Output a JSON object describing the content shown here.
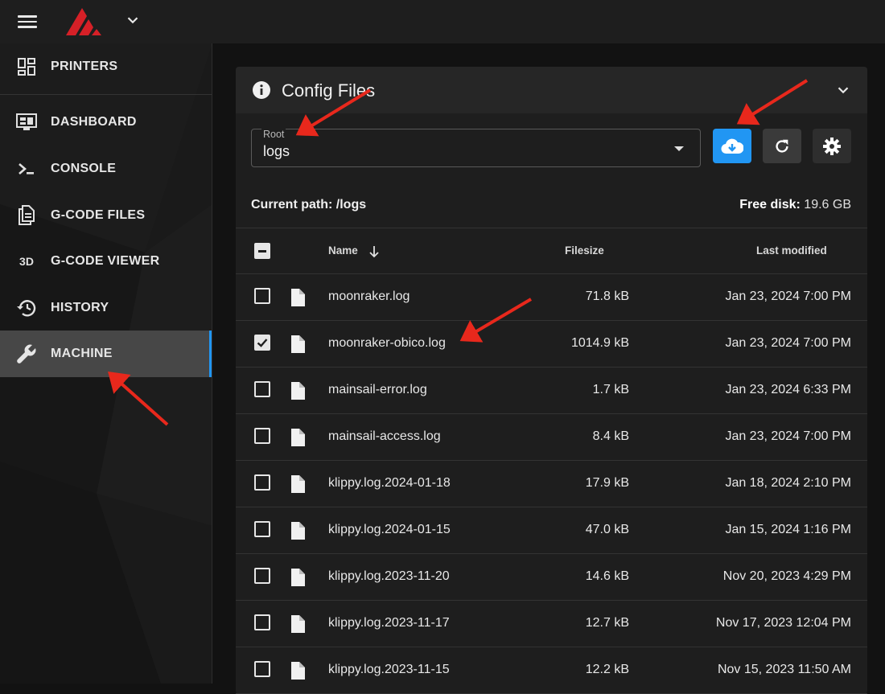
{
  "colors": {
    "accent": "#2196f3",
    "annotation_arrow": "#e8281c",
    "logo": "#d62027"
  },
  "sidebar": {
    "items": [
      {
        "label": "PRINTERS",
        "icon": "dashboard-grid-icon"
      },
      {
        "label": "DASHBOARD",
        "icon": "monitor-dashboard-icon"
      },
      {
        "label": "CONSOLE",
        "icon": "console-prompt-icon"
      },
      {
        "label": "G-CODE FILES",
        "icon": "file-document-icon"
      },
      {
        "label": "G-CODE VIEWER",
        "icon": "3d-icon",
        "icon_text": "3D"
      },
      {
        "label": "HISTORY",
        "icon": "history-icon"
      },
      {
        "label": "MACHINE",
        "icon": "wrench-icon",
        "active": true
      }
    ]
  },
  "panel": {
    "title": "Config Files",
    "root_label": "Root",
    "root_value": "logs",
    "current_path_label": "Current path:",
    "current_path_value": "/logs",
    "free_disk_label": "Free disk:",
    "free_disk_value": "19.6 GB"
  },
  "table": {
    "headers": {
      "name": "Name",
      "filesize": "Filesize",
      "modified": "Last modified"
    },
    "rows": [
      {
        "name": "moonraker.log",
        "size": "71.8 kB",
        "modified": "Jan 23, 2024 7:00 PM",
        "checked": false
      },
      {
        "name": "moonraker-obico.log",
        "size": "1014.9 kB",
        "modified": "Jan 23, 2024 7:00 PM",
        "checked": true
      },
      {
        "name": "mainsail-error.log",
        "size": "1.7 kB",
        "modified": "Jan 23, 2024 6:33 PM",
        "checked": false
      },
      {
        "name": "mainsail-access.log",
        "size": "8.4 kB",
        "modified": "Jan 23, 2024 7:00 PM",
        "checked": false
      },
      {
        "name": "klippy.log.2024-01-18",
        "size": "17.9 kB",
        "modified": "Jan 18, 2024 2:10 PM",
        "checked": false
      },
      {
        "name": "klippy.log.2024-01-15",
        "size": "47.0 kB",
        "modified": "Jan 15, 2024 1:16 PM",
        "checked": false
      },
      {
        "name": "klippy.log.2023-11-20",
        "size": "14.6 kB",
        "modified": "Nov 20, 2023 4:29 PM",
        "checked": false
      },
      {
        "name": "klippy.log.2023-11-17",
        "size": "12.7 kB",
        "modified": "Nov 17, 2023 12:04 PM",
        "checked": false
      },
      {
        "name": "klippy.log.2023-11-15",
        "size": "12.2 kB",
        "modified": "Nov 15, 2023 11:50 AM",
        "checked": false
      }
    ]
  }
}
